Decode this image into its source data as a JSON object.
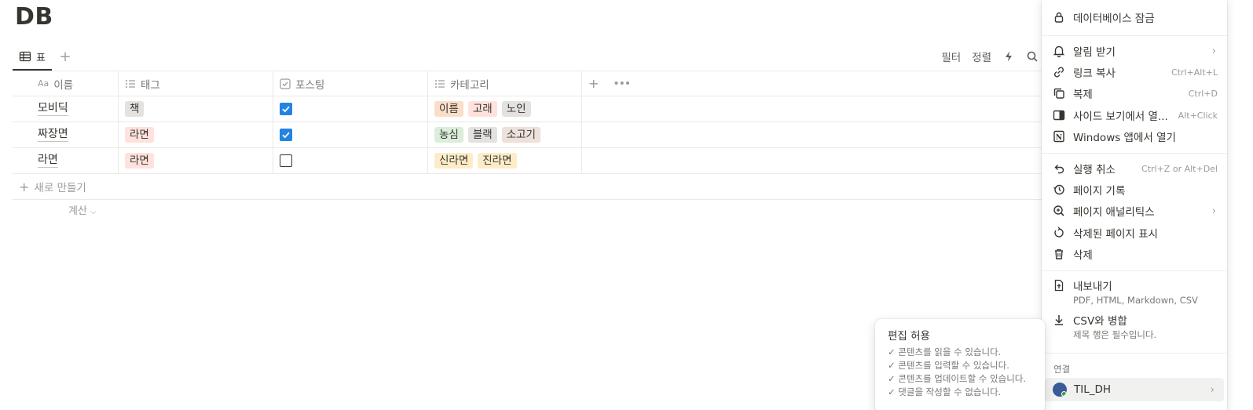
{
  "page": {
    "title": "DB"
  },
  "view": {
    "tab_label": "표",
    "add_icon": "plus-icon",
    "toolbar": {
      "filter": "필터",
      "sort": "정렬",
      "automation_icon": "lightning-icon",
      "search_icon": "search-icon"
    }
  },
  "table": {
    "columns": [
      {
        "label": "이름",
        "icon_text": "Aa"
      },
      {
        "label": "태그",
        "icon": "list-icon"
      },
      {
        "label": "포스팅",
        "icon": "checkbox-icon"
      },
      {
        "label": "카테고리",
        "icon": "list-icon"
      }
    ],
    "rows": [
      {
        "name": "모비딕",
        "tags": [
          {
            "text": "책",
            "color": "#e3e2e0"
          }
        ],
        "posted": true,
        "categories": [
          {
            "text": "이름",
            "color": "#fadec9"
          },
          {
            "text": "고래",
            "color": "#ffe2dd"
          },
          {
            "text": "노인",
            "color": "#e3e2e0"
          }
        ]
      },
      {
        "name": "짜장면",
        "tags": [
          {
            "text": "라면",
            "color": "#ffe2dd"
          }
        ],
        "posted": true,
        "categories": [
          {
            "text": "농심",
            "color": "#dbeddb"
          },
          {
            "text": "블랙",
            "color": "#e3e2e0"
          },
          {
            "text": "소고기",
            "color": "#eee0da"
          }
        ]
      },
      {
        "name": "라면",
        "tags": [
          {
            "text": "라면",
            "color": "#ffe2dd"
          }
        ],
        "posted": false,
        "categories": [
          {
            "text": "신라면",
            "color": "#fdecc8"
          },
          {
            "text": "진라면",
            "color": "#fdecc8"
          }
        ]
      }
    ],
    "new_row_label": "새로 만들기",
    "calc_label": "계산"
  },
  "menu": {
    "lock_db": "데이터베이스 잠금",
    "notify": "알림 받기",
    "copy_link": "링크 복사",
    "copy_link_shortcut": "Ctrl+Alt+L",
    "duplicate": "복제",
    "duplicate_shortcut": "Ctrl+D",
    "open_side_peek": "사이드 보기에서 열...",
    "open_side_peek_shortcut": "Alt+Click",
    "open_windows_app": "Windows 앱에서 열기",
    "undo": "실행 취소",
    "undo_shortcut": "Ctrl+Z or Alt+Del",
    "page_history": "페이지 기록",
    "page_analytics": "페이지 애널리틱스",
    "show_deleted": "삭제된 페이지 표시",
    "delete": "삭제",
    "export": "내보내기",
    "export_sub": "PDF, HTML, Markdown, CSV",
    "merge_csv": "CSV와 병합",
    "merge_csv_sub": "제목 행은 필수입니다.",
    "connections_header": "연결",
    "connection_name": "TIL_DH"
  },
  "tooltip": {
    "title": "편집 허용",
    "lines": [
      "✓ 콘텐츠를 읽을 수 있습니다.",
      "✓ 콘텐츠를 입력할 수 있습니다.",
      "✓ 콘텐츠를 업데이트할 수 있습니다.",
      "✓ 댓글을 작성할 수 없습니다."
    ]
  },
  "colors": {
    "accent": "#2383e2",
    "text": "#37352f",
    "muted": "#9b9a97"
  }
}
